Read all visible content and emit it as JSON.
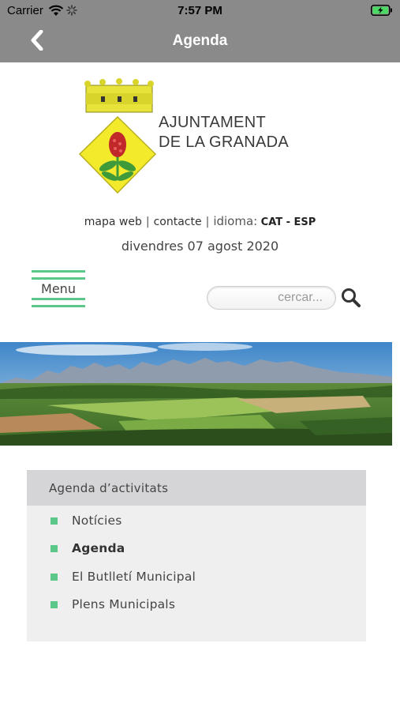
{
  "status_bar": {
    "carrier": "Carrier",
    "time": "7:57 PM"
  },
  "nav": {
    "title": "Agenda",
    "back_icon": "chevron-left-icon"
  },
  "header": {
    "logo_line1": "AJUNTAMENT",
    "logo_line2": "DE LA GRANADA",
    "links": {
      "mapa_web": "mapa web",
      "separator": "|",
      "contacte": "contacte",
      "idioma": "idioma:",
      "cat": "CAT",
      "dash": "-",
      "esp": "ESP"
    },
    "date": "divendres 07 agost 2020"
  },
  "menu": {
    "label": "Menu"
  },
  "search": {
    "placeholder": "cercar...",
    "icon": "search-icon"
  },
  "panel": {
    "title": "Agenda d’activitats",
    "items": [
      {
        "label": "Notícies",
        "active": false
      },
      {
        "label": "Agenda",
        "active": true
      },
      {
        "label": "El Butlletí Municipal",
        "active": false
      },
      {
        "label": "Plens Municipals",
        "active": false
      }
    ]
  },
  "colors": {
    "bar_gray": "#8a8a8a",
    "accent_green": "#5bc88a",
    "panel_bg": "#efefef",
    "panel_header": "#d5d5d7"
  }
}
